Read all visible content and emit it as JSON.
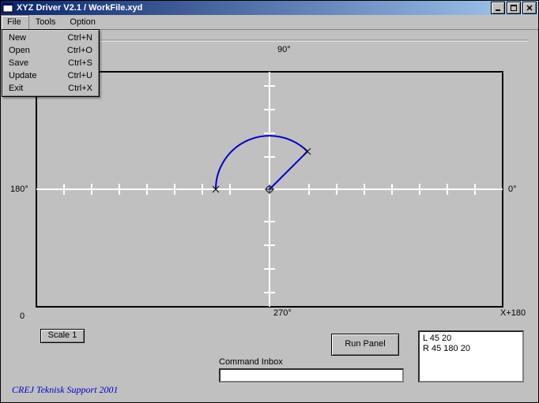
{
  "window": {
    "title": "XYZ Driver V2.1 / WorkFile.xyd"
  },
  "menubar": {
    "file": "File",
    "tools": "Tools",
    "option": "Option"
  },
  "dropdown": {
    "new": {
      "label": "New",
      "shortcut": "Ctrl+N"
    },
    "open": {
      "label": "Open",
      "shortcut": "Ctrl+O"
    },
    "save": {
      "label": "Save",
      "shortcut": "Ctrl+S"
    },
    "update": {
      "label": "Update",
      "shortcut": "Ctrl+U"
    },
    "exit": {
      "label": "Exit",
      "shortcut": "Ctrl+X"
    }
  },
  "axes": {
    "top": "90°",
    "bottom": "270°",
    "left": "180°",
    "right": "0°",
    "x_right_end": "X+180",
    "origin_zero": "0"
  },
  "buttons": {
    "scale": "Scale 1",
    "run": "Run Panel"
  },
  "command": {
    "label": "Command Inbox",
    "value": ""
  },
  "output": {
    "line1": "L 45 20",
    "line2": "R 45 180 20"
  },
  "footer": "CREJ Teknisk Support  2001",
  "colors": {
    "arc": "#0000cc",
    "axes": "#ffffff",
    "frame": "#000000"
  },
  "chart_data": {
    "type": "polar-arc",
    "axis_labels_deg": [
      0,
      90,
      180,
      270
    ],
    "ticks_step_deg": 15,
    "arc": {
      "start_deg": 180,
      "end_deg": 45,
      "radius_units": 4
    },
    "origin_to_end_line": true,
    "scale": 1
  }
}
